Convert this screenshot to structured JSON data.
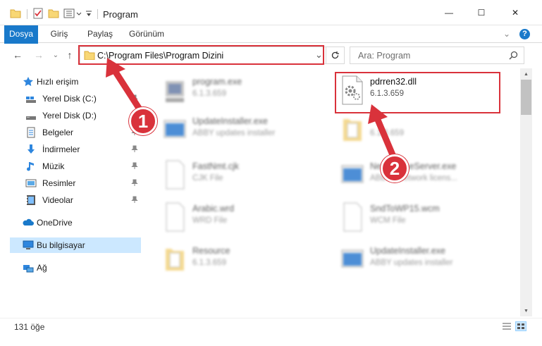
{
  "window": {
    "title": "Program",
    "minimize_glyph": "—",
    "maximize_glyph": "☐",
    "close_glyph": "✕"
  },
  "ribbon": {
    "tabs": [
      {
        "label": "Dosya",
        "active": true
      },
      {
        "label": "Giriş"
      },
      {
        "label": "Paylaş"
      },
      {
        "label": "Görünüm"
      }
    ],
    "expand_glyph": "⌄",
    "help_glyph": "?"
  },
  "nav": {
    "back_glyph": "←",
    "forward_glyph": "→",
    "recent_glyph": "⌄",
    "up_glyph": "↑",
    "address": "C:\\Program Files\\Program Dizini",
    "dropdown_glyph": "⌄",
    "search_placeholder": "Ara: Program"
  },
  "sidebar": {
    "quick_access": "Hızlı erişim",
    "items": [
      {
        "label": "Yerel Disk (C:)",
        "icon": "drive-icon",
        "pinned": true
      },
      {
        "label": "Yerel Disk (D:)",
        "icon": "drive-icon",
        "pinned": false
      },
      {
        "label": "Belgeler",
        "icon": "documents-icon",
        "pinned": true
      },
      {
        "label": "İndirmeler",
        "icon": "downloads-icon",
        "pinned": true
      },
      {
        "label": "Müzik",
        "icon": "music-icon",
        "pinned": true
      },
      {
        "label": "Resimler",
        "icon": "pictures-icon",
        "pinned": true
      },
      {
        "label": "Videolar",
        "icon": "videos-icon",
        "pinned": true
      }
    ],
    "onedrive": "OneDrive",
    "this_pc": "Bu bilgisayar",
    "network": "Ağ"
  },
  "files": [
    {
      "name": "program.exe",
      "sub": "6.1.3.659",
      "icon": "exe-icon",
      "blurred": true
    },
    {
      "name": "pdrren32.dll",
      "sub": "6.1.3.659",
      "icon": "dll-gear-icon",
      "blurred": false
    },
    {
      "name": "UpdateInstaller.exe",
      "sub": "ABBY updates installer",
      "icon": "window-app-icon",
      "blurred": true
    },
    {
      "name": "",
      "sub": "6.1.3.659",
      "icon": "folder-doc-icon",
      "blurred": true
    },
    {
      "name": "FastNmt.cjk",
      "sub": "CJK File",
      "icon": "blank-file-icon",
      "blurred": true
    },
    {
      "name": "NetLicenseServer.exe",
      "sub": "ABBYY network licens...",
      "icon": "window-app-icon",
      "blurred": true
    },
    {
      "name": "Arabic.wrd",
      "sub": "WRD File",
      "icon": "blank-file-icon",
      "blurred": true
    },
    {
      "name": "SndToWP15.wcm",
      "sub": "WCM File",
      "icon": "blank-file-icon",
      "blurred": true
    },
    {
      "name": "Resource",
      "sub": "6.1.3.659",
      "icon": "folder-doc-icon",
      "blurred": true
    },
    {
      "name": "UpdateInstaller.exe",
      "sub": "ABBY updates installer",
      "icon": "window-app-icon",
      "blurred": true
    }
  ],
  "status": {
    "count": "131 öğe"
  },
  "annotations": [
    {
      "label": "1"
    },
    {
      "label": "2"
    }
  ],
  "colors": {
    "accent": "#1979ca",
    "highlight": "#d9323b",
    "selected_bg": "#cce8ff"
  }
}
